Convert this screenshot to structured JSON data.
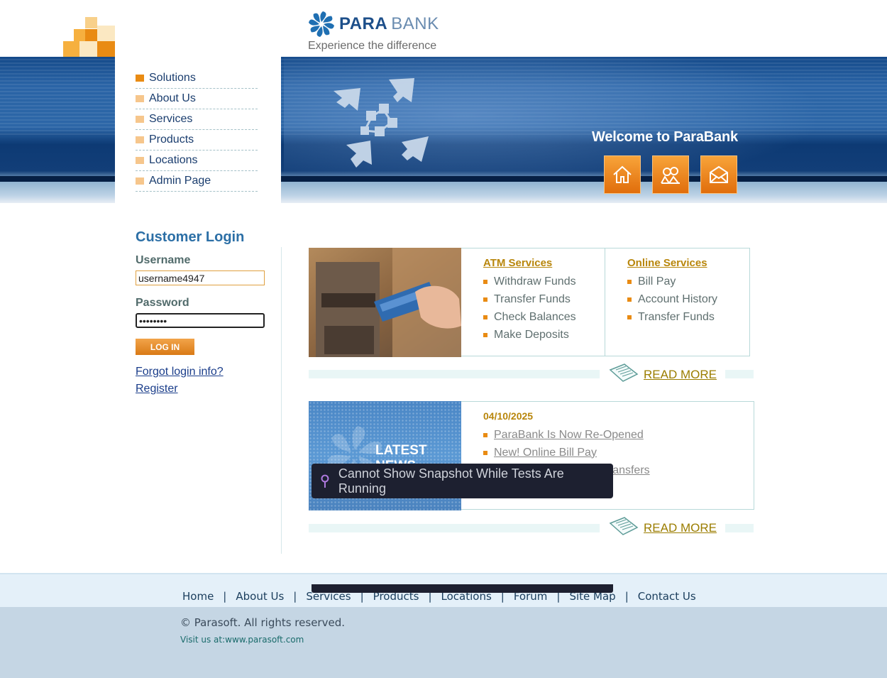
{
  "header": {
    "brand_para": "PARA",
    "brand_bank": "BANK",
    "tagline": "Experience the difference"
  },
  "menu": {
    "items": [
      {
        "label": "Solutions"
      },
      {
        "label": "About Us"
      },
      {
        "label": "Services"
      },
      {
        "label": "Products"
      },
      {
        "label": "Locations"
      },
      {
        "label": "Admin Page"
      }
    ]
  },
  "hero": {
    "welcome": "Welcome to ParaBank",
    "icons": [
      "home-icon",
      "contact-people-icon",
      "envelope-icon"
    ]
  },
  "login": {
    "title": "Customer Login",
    "username_label": "Username",
    "username_value": "username4947",
    "password_label": "Password",
    "password_value": "password",
    "button_label": "LOG IN",
    "forgot_link": "Forgot login info?",
    "register_link": "Register"
  },
  "services": {
    "atm": {
      "heading": "ATM Services",
      "items": [
        "Withdraw Funds",
        "Transfer Funds",
        "Check Balances",
        "Make Deposits"
      ]
    },
    "online": {
      "heading": "Online Services",
      "items": [
        "Bill Pay",
        "Account History",
        "Transfer Funds"
      ]
    },
    "read_more": "READ MORE"
  },
  "news": {
    "image_title": "LATEST NEWS",
    "date": "04/10/2025",
    "items": [
      "ParaBank Is Now Re-Opened",
      "New! Online Bill Pay",
      "New! Online Account Transfers"
    ],
    "read_more": "READ MORE"
  },
  "tooltip": {
    "text": "Cannot Show Snapshot While Tests Are Running"
  },
  "footer": {
    "links": [
      "Home",
      "About Us",
      "Services",
      "Products",
      "Locations",
      "Forum",
      "Site Map",
      "Contact Us"
    ],
    "separator": "|",
    "copyright": "© Parasoft. All rights reserved.",
    "visit": "Visit us at:www.parasoft.com"
  },
  "colors": {
    "accent_orange": "#e98b13",
    "header_blue": "#1d4f8a",
    "link_gold": "#b8860b"
  }
}
